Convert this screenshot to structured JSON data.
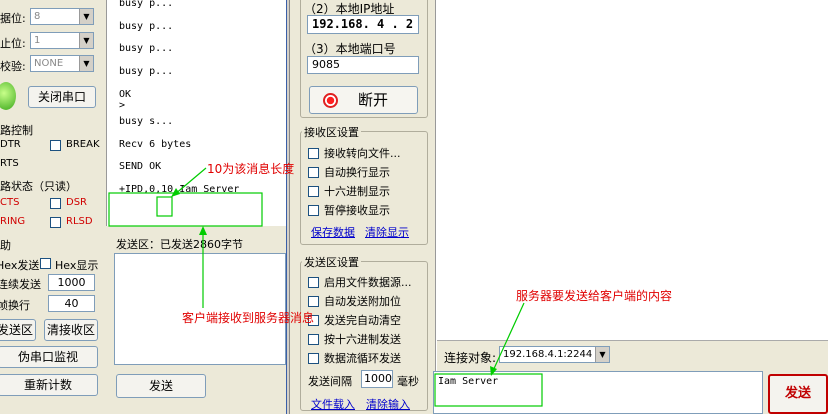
{
  "left_panel": {
    "data_bits_label": "据位:",
    "data_bits_value": "8",
    "stop_bits_label": "止位:",
    "stop_bits_value": "1",
    "parity_label": "校验:",
    "parity_value": "NONE",
    "close_port_button": "关闭串口",
    "line_control_title": "路控制",
    "dtr_label": "DTR",
    "break_label": "BREAK",
    "rts_label": "RTS",
    "line_status_title": "路状态（只读）",
    "cts_label": "CTS",
    "dsr_label": "DSR",
    "ring_label": "RING",
    "rlsd_label": "RLSD",
    "aux_title": "助",
    "hex_send_label": "Hex发送",
    "hex_show_label": "Hex显示",
    "continuous_send_label": "连续发送",
    "continuous_send_value": "1000",
    "newline_label": "帧换行",
    "newline_value": "40",
    "send_area_button": "发送区",
    "clear_receive_button": "清接收区",
    "fake_monitor_button": "伪串口监视",
    "recount_button": "重新计数"
  },
  "log": {
    "lines": [
      "busy p...",
      "busy p...",
      "busy p...",
      "busy p...",
      "OK",
      ">",
      "busy s...",
      "Recv 6 bytes",
      "SEND OK",
      "+IPD,0,10 Iam Server"
    ]
  },
  "middle_bottom": {
    "send_area_label": "发送区：已发送2860字节",
    "send_button": "发送"
  },
  "net_panel": {
    "local_ip_label": "（2）本地IP地址",
    "local_ip_value": "192.168. 4 . 2",
    "local_port_label": "（3）本地端口号",
    "local_port_value": "9085",
    "disconnect_button": "断开",
    "recv_settings_title": "接收区设置",
    "recv_to_file": "接收转向文件...",
    "auto_newline": "自动换行显示",
    "hex_display": "十六进制显示",
    "pause_display": "暂停接收显示",
    "save_data_link": "保存数据",
    "clear_display_link": "清除显示",
    "send_settings_title": "发送区设置",
    "enable_file_source": "启用文件数据源...",
    "auto_append": "自动发送附加位",
    "clear_after_send": "发送完自动清空",
    "send_as_hex": "按十六进制发送",
    "loop_send": "数据流循环发送",
    "send_interval_label": "发送间隔",
    "send_interval_value": "1000",
    "send_interval_unit": "毫秒",
    "file_load_link": "文件载入",
    "clear_input_link": "清除输入"
  },
  "right_panel": {
    "connect_target_label": "连接对象:",
    "connect_target_value": "192.168.4.1:2244",
    "send_text": "Iam Server",
    "send_button": "发送"
  },
  "annotations": {
    "msg_length_note": "10为该消息长度",
    "client_recv_note": "客户端接收到服务器消息",
    "server_send_note": "服务器要发送给客户端的内容"
  },
  "colors": {
    "panel_bg": "#ece9d8",
    "annotation_red": "#e00000",
    "annotation_green": "#00cc00",
    "divider_blue": "#3a5fa8"
  }
}
